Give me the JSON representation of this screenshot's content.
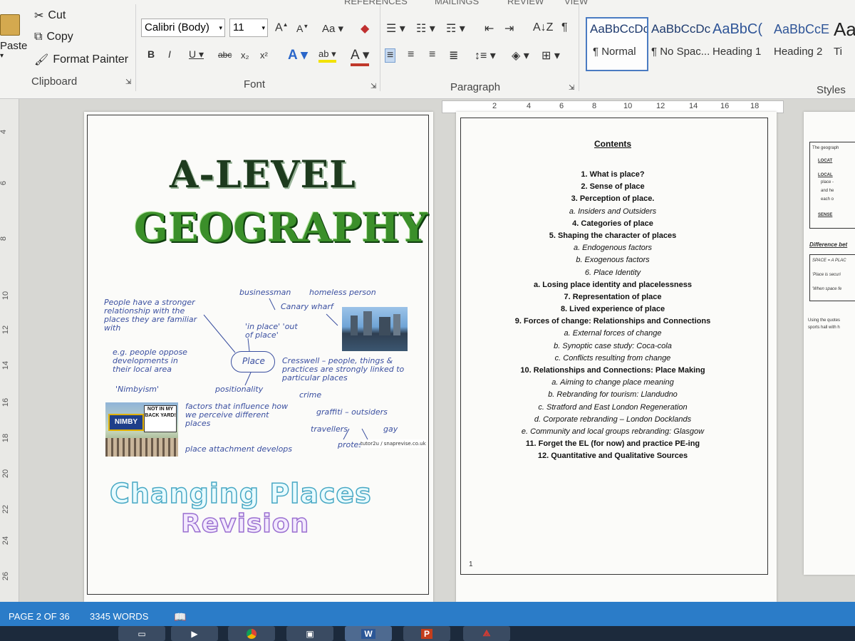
{
  "ribbon": {
    "tabs": [
      "REFERENCES",
      "MAILINGS",
      "REVIEW",
      "VIEW"
    ],
    "clipboard": {
      "paste": "Paste",
      "cut": "Cut",
      "copy": "Copy",
      "format_painter": "Format Painter",
      "label": "Clipboard"
    },
    "font": {
      "name": "Calibri (Body)",
      "size": "11",
      "label": "Font"
    },
    "paragraph": {
      "label": "Paragraph"
    },
    "styles": {
      "label": "Styles",
      "items": [
        {
          "preview": "AaBbCcDc",
          "name": "¶ Normal"
        },
        {
          "preview": "AaBbCcDc",
          "name": "¶ No Spac..."
        },
        {
          "preview": "AaBbC(",
          "name": "Heading 1"
        },
        {
          "preview": "AaBbCcE",
          "name": "Heading 2"
        },
        {
          "preview": "Aa",
          "name": "Ti"
        }
      ]
    }
  },
  "ruler": {
    "h_ticks": [
      "2",
      "4",
      "6",
      "8",
      "10",
      "12",
      "14",
      "16",
      "18"
    ],
    "v_ticks": [
      "4",
      "6",
      "8",
      "10",
      "12",
      "14",
      "16",
      "18",
      "20",
      "22",
      "24",
      "26"
    ]
  },
  "cover": {
    "title_line1": "A-LEVEL",
    "title_line2": "GEOGRAPHY",
    "notes": {
      "people": "People have a stronger relationship with the places they are familiar with",
      "eg": "e.g. people oppose developments in their local area",
      "nimbyism": "'Nimbyism'",
      "businessman": "businessman",
      "homeless": "homeless person",
      "canary": "Canary wharf",
      "inplace": "'in place' 'out of place'",
      "place": "Place",
      "cresswell": "Cresswell – people, things & practices are strongly linked to particular places",
      "positionality": "positionality",
      "crime": "crime",
      "factors": "factors that influence how we perceive different places",
      "graffiti": "graffiti – outsiders",
      "travellers": "travellers",
      "gay": "gay",
      "place_attach": "place attachment develops",
      "protest": "protest",
      "watermark": "tutor2u / snaprevise.co.uk"
    },
    "nimby_sign": {
      "left": "NIMBY",
      "right": "NOT IN MY BACK YARD!"
    },
    "changing": "Changing Places",
    "revision": "Revision"
  },
  "contents": {
    "title": "Contents",
    "items": [
      {
        "t": "1.  What is place?",
        "kind": "main"
      },
      {
        "t": "2.  Sense of place",
        "kind": "main"
      },
      {
        "t": "3.  Perception of place.",
        "kind": "main"
      },
      {
        "t": "a.  Insiders and Outsiders",
        "kind": "sub"
      },
      {
        "t": "4.  Categories of place",
        "kind": "main"
      },
      {
        "t": "5.  Shaping the character of places",
        "kind": "main"
      },
      {
        "t": "a.  Endogenous factors",
        "kind": "sub"
      },
      {
        "t": "b.  Exogenous factors",
        "kind": "sub"
      },
      {
        "t": "6.  Place Identity",
        "kind": "sub"
      },
      {
        "t": "a.  Losing place identity and placelessness",
        "kind": "main"
      },
      {
        "t": "7.  Representation of place",
        "kind": "main"
      },
      {
        "t": "8.  Lived experience of place",
        "kind": "main"
      },
      {
        "t": "9.  Forces of change: Relationships and Connections",
        "kind": "main"
      },
      {
        "t": "a.  External forces of change",
        "kind": "sub"
      },
      {
        "t": "b.  Synoptic case study: Coca-cola",
        "kind": "sub"
      },
      {
        "t": "c.  Conflicts resulting from change",
        "kind": "sub"
      },
      {
        "t": "10.   Relationships and Connections: Place Making",
        "kind": "main"
      },
      {
        "t": "a.  Aiming to change place meaning",
        "kind": "sub"
      },
      {
        "t": "b.  Rebranding for tourism: Llandudno",
        "kind": "sub"
      },
      {
        "t": "c.  Stratford and East London Regeneration",
        "kind": "sub"
      },
      {
        "t": "d.  Corporate rebranding – London Docklands",
        "kind": "sub"
      },
      {
        "t": "e.  Community and local groups rebranding: Glasgow",
        "kind": "sub"
      },
      {
        "t": "11.   Forget the EL (for now) and practice PE-ing",
        "kind": "main"
      },
      {
        "t": "12.   Quantitative and Qualitative Sources",
        "kind": "main"
      }
    ],
    "page_number": "1"
  },
  "third_page": {
    "lines": [
      "The geograph",
      "LOCAT",
      "LOCAL",
      "place -",
      "and he",
      "each o",
      "SENSE",
      "Difference bet",
      "SPACE = A PLAC",
      "'Place is securi",
      "'When space fe",
      "Using the quotes",
      "sports hall with h"
    ]
  },
  "status": {
    "page": "PAGE 2 OF 36",
    "words": "3345 WORDS"
  },
  "taskbar": {
    "word": "W",
    "ppt": "P"
  }
}
